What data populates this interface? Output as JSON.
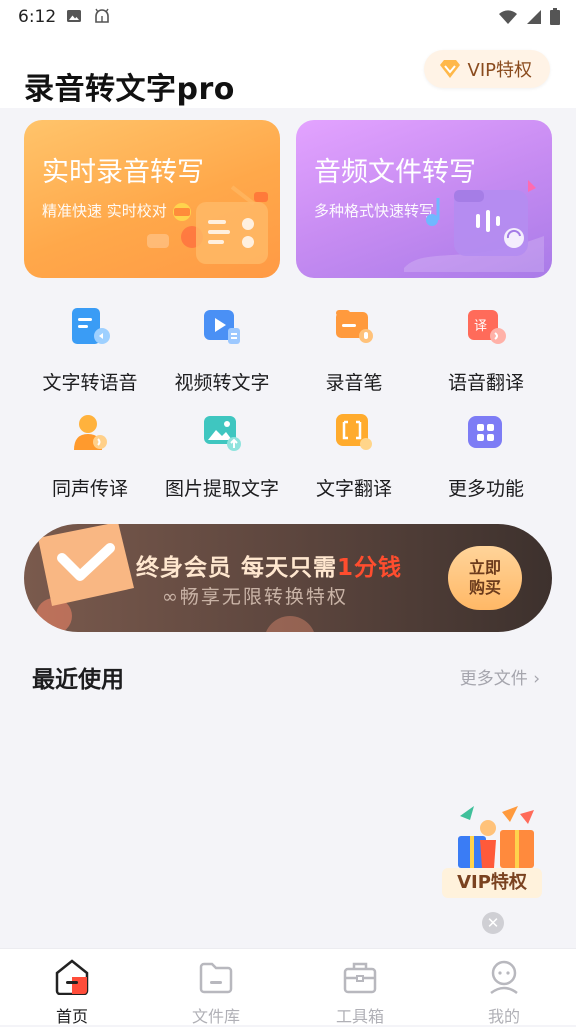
{
  "status_bar": {
    "time": "6:12",
    "notification_icons": [
      "image-icon",
      "android-debug-icon"
    ],
    "system_icons": [
      "wifi-icon",
      "signal-icon",
      "battery-icon"
    ]
  },
  "header": {
    "title": "录音转文字pro",
    "vip_label": "VIP特权"
  },
  "cards": [
    {
      "title": "实时录音转写",
      "subtitle": "精准快速 实时校对",
      "icon": "radio-icon",
      "color": "#ffa84a"
    },
    {
      "title": "音频文件转写",
      "subtitle": "多种格式快速转写",
      "icon": "audio-folder-icon",
      "color": "#c78cf2"
    }
  ],
  "features": [
    {
      "label": "文字转语音",
      "icon": "text-to-speech-icon"
    },
    {
      "label": "视频转文字",
      "icon": "video-to-text-icon"
    },
    {
      "label": "录音笔",
      "icon": "recorder-pen-icon"
    },
    {
      "label": "语音翻译",
      "icon": "voice-translate-icon"
    },
    {
      "label": "同声传译",
      "icon": "simultaneous-interpret-icon"
    },
    {
      "label": "图片提取文字",
      "icon": "image-ocr-icon"
    },
    {
      "label": "文字翻译",
      "icon": "text-translate-icon"
    },
    {
      "label": "更多功能",
      "icon": "more-features-icon"
    }
  ],
  "banner": {
    "line1_prefix": "终身会员 每天只需",
    "line1_highlight": "1分钱",
    "line2": "∞畅享无限转换特权",
    "button_line1": "立即",
    "button_line2": "购买"
  },
  "recent": {
    "title": "最近使用",
    "more_label": "更多文件 ›"
  },
  "floating_vip": {
    "label": "VIP特权",
    "close_symbol": "✕"
  },
  "tabs": [
    {
      "label": "首页",
      "icon": "home-icon",
      "active": true
    },
    {
      "label": "文件库",
      "icon": "folder-icon",
      "active": false
    },
    {
      "label": "工具箱",
      "icon": "toolbox-icon",
      "active": false
    },
    {
      "label": "我的",
      "icon": "profile-icon",
      "active": false
    }
  ],
  "colors": {
    "accent_red": "#ff4d2e",
    "vip_text": "#8a4b1e",
    "orange_card": "#ffa84a",
    "purple_card": "#c78cf2"
  }
}
